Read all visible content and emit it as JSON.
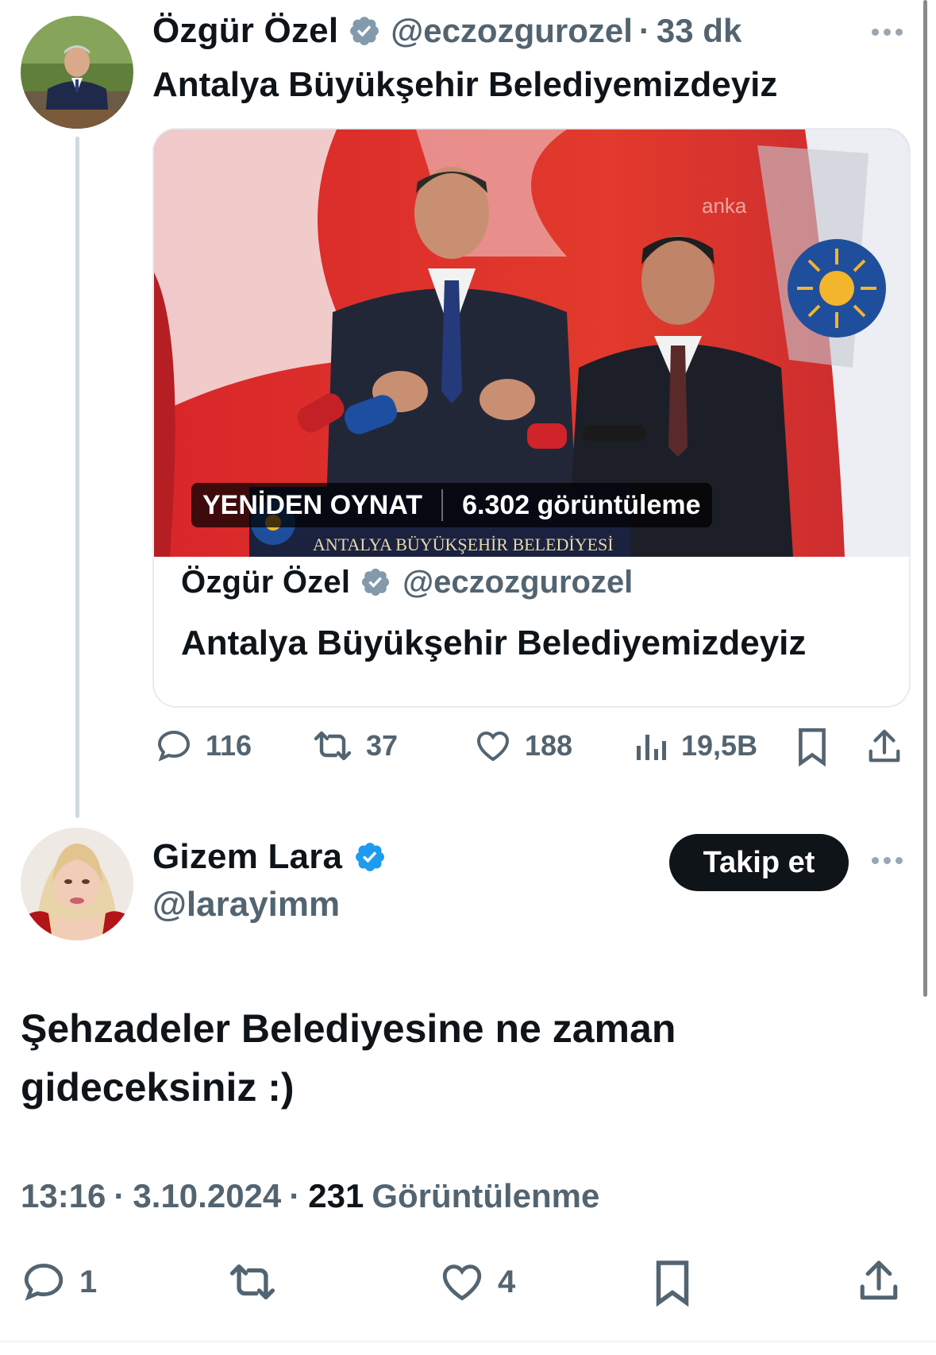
{
  "quoted_tweet": {
    "author_name": "Özgür Özel",
    "handle": "@eczozgurozel",
    "separator": "·",
    "time_ago": "33 dk",
    "text": "Antalya Büyükşehir Belediyemizdeyiz",
    "video": {
      "replay_label": "YENİDEN OYNAT",
      "views_label": "6.302 görüntüleme",
      "watermark": "anka",
      "podium_text": "ANTALYA BÜYÜKŞEHİR BELEDİYESİ",
      "flag_text": "ANTALYA BÜYÜKŞEHİR BELEDİYESİ"
    },
    "card_author_name": "Özgür Özel",
    "card_handle": "@eczozgurozel",
    "card_text": "Antalya Büyükşehir Belediyemizdeyiz",
    "stats": {
      "replies": "116",
      "reposts": "37",
      "likes": "188",
      "views": "19,5B"
    }
  },
  "main_tweet": {
    "author_name": "Gizem Lara",
    "handle": "@larayimm",
    "follow_label": "Takip et",
    "text_line1": "Şehzadeler Belediyesine ne zaman",
    "text_line2": "gideceksiniz :)",
    "time": "13:16",
    "date": "3.10.2024",
    "dot": "·",
    "view_count": "231",
    "views_word": "Görüntülenme",
    "stats": {
      "replies": "1",
      "likes": "4"
    }
  },
  "colors": {
    "verified_gray": "#829aab",
    "verified_blue": "#1d9bf0",
    "text": "#0f1419",
    "muted": "#536471"
  },
  "icons": [
    "reply-icon",
    "repost-icon",
    "like-icon",
    "views-icon",
    "bookmark-icon",
    "share-icon",
    "verified-badge-icon",
    "more-icon"
  ]
}
